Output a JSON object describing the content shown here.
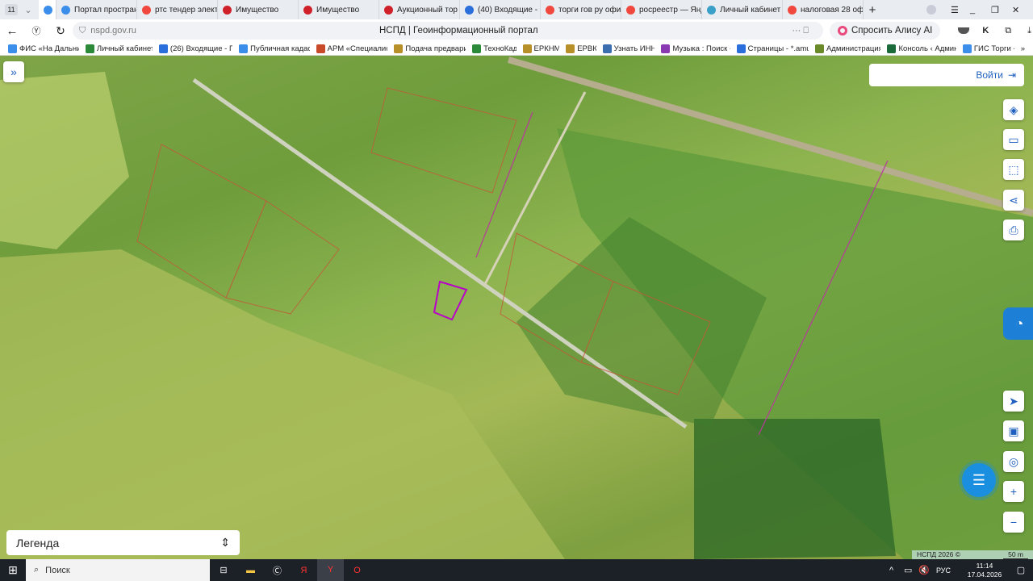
{
  "browser": {
    "tab_count": "11",
    "tabs": [
      {
        "label": "Портал простран",
        "color": "#3b8eea"
      },
      {
        "label": "ртс тендер элект",
        "color": "#f0483e"
      },
      {
        "label": "Имущество",
        "color": "#d0202a"
      },
      {
        "label": "Имущество",
        "color": "#d0202a"
      },
      {
        "label": "Аукционный тор",
        "color": "#d0202a"
      },
      {
        "label": "(40) Входящие - I",
        "color": "#2a6fdb"
      },
      {
        "label": "торги гов ру офи",
        "color": "#f0483e"
      },
      {
        "label": "росреестр — Янд",
        "color": "#f0483e"
      },
      {
        "label": "Личный кабинет",
        "color": "#3aa0c8"
      },
      {
        "label": "налоговая 28 офи",
        "color": "#f0483e"
      }
    ],
    "new_tab": "+",
    "url": "nspd.gov.ru",
    "page_title": "НСПД | Геоинформационный портал",
    "alice_button": "Спросить Алису AI",
    "bookmarks": [
      "ФИС «На Дальни",
      "Личный кабинет",
      "(26) Входящие - П",
      "Публичная кадас",
      "АРМ «Специалис",
      "Подача предвари",
      "ТехноКад",
      "ЕРКНМ",
      "ЕРВК",
      "Узнать ИНН",
      "Музыка : Поиск -",
      "Страницы - *.amu",
      "Администрация",
      "Консоль ‹ Админ",
      "ГИС Торги -"
    ],
    "bookmarks_more": "»"
  },
  "map": {
    "expand_icon": "»",
    "login_button": "Войти",
    "right_tools": [
      "layers-icon",
      "ruler-icon",
      "select-area-icon",
      "share-icon",
      "print-icon"
    ],
    "nav_tools": [
      "locate-icon",
      "screen-icon",
      "geo-icon"
    ],
    "zoom_in": "+",
    "zoom_out": "−",
    "legend_label": "Легенда",
    "copyright": "НСПД 2026 ©",
    "scale": "50 m"
  },
  "taskbar": {
    "search_placeholder": "Поиск",
    "lang": "РУС",
    "time": "11:14",
    "date": "17.04.2026"
  }
}
